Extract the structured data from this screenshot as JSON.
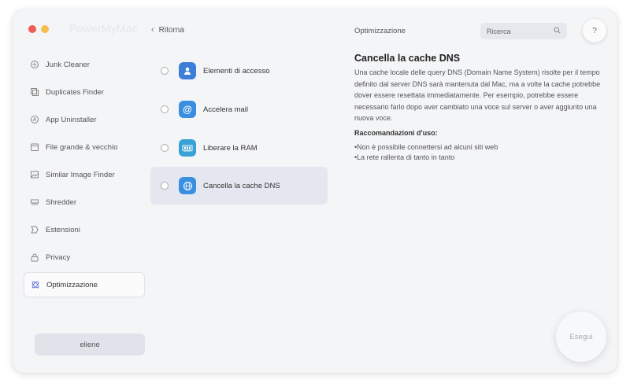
{
  "app": {
    "name": "PowerMyMac"
  },
  "sidebar": {
    "items": [
      {
        "label": "Junk Cleaner",
        "icon": "junk-cleaner-icon"
      },
      {
        "label": "Duplicates Finder",
        "icon": "duplicates-icon"
      },
      {
        "label": "App Uninstaller",
        "icon": "uninstaller-icon"
      },
      {
        "label": "File grande & vecchio",
        "icon": "large-file-icon"
      },
      {
        "label": "Similar Image Finder",
        "icon": "image-icon"
      },
      {
        "label": "Shredder",
        "icon": "shredder-icon"
      },
      {
        "label": "Estensioni",
        "icon": "extensions-icon"
      },
      {
        "label": "Privacy",
        "icon": "lock-icon"
      },
      {
        "label": "Optimizzazione",
        "icon": "optimization-icon",
        "active": true
      }
    ],
    "user": "eliene"
  },
  "nav": {
    "back_label": "Ritorna"
  },
  "header": {
    "title": "Optimizzazione",
    "search_placeholder": "Ricerca",
    "help_label": "?"
  },
  "options": [
    {
      "label": "Elementi di accesso",
      "icon": "user-icon",
      "color": "#3d7fd8"
    },
    {
      "label": "Accelera mail",
      "icon": "mail-at-icon",
      "color": "#3a8ee0"
    },
    {
      "label": "Liberare la RAM",
      "icon": "ram-icon",
      "color": "#37a2d6"
    },
    {
      "label": "Cancella la cache DNS",
      "icon": "dns-globe-icon",
      "color": "#3a90e0",
      "selected": true
    }
  ],
  "detail": {
    "title": "Cancella la cache DNS",
    "description": "Una cache locale delle query DNS (Domain Name System) risolte per il tempo definito dal server DNS sarà mantenuta dal Mac, ma a volte la cache potrebbe dover essere resettata immediatamente. Per esempio, potrebbe essere necessario farlo dopo aver cambiato una voce sul server o aver aggiunto una nuova voce.",
    "recommendations_title": "Raccomandazioni d'uso:",
    "recommendations": [
      "•Non è possibile connettersi ad alcuni siti web",
      "•La rete rallenta di tanto in tanto"
    ]
  },
  "actions": {
    "run_label": "Esegui"
  }
}
